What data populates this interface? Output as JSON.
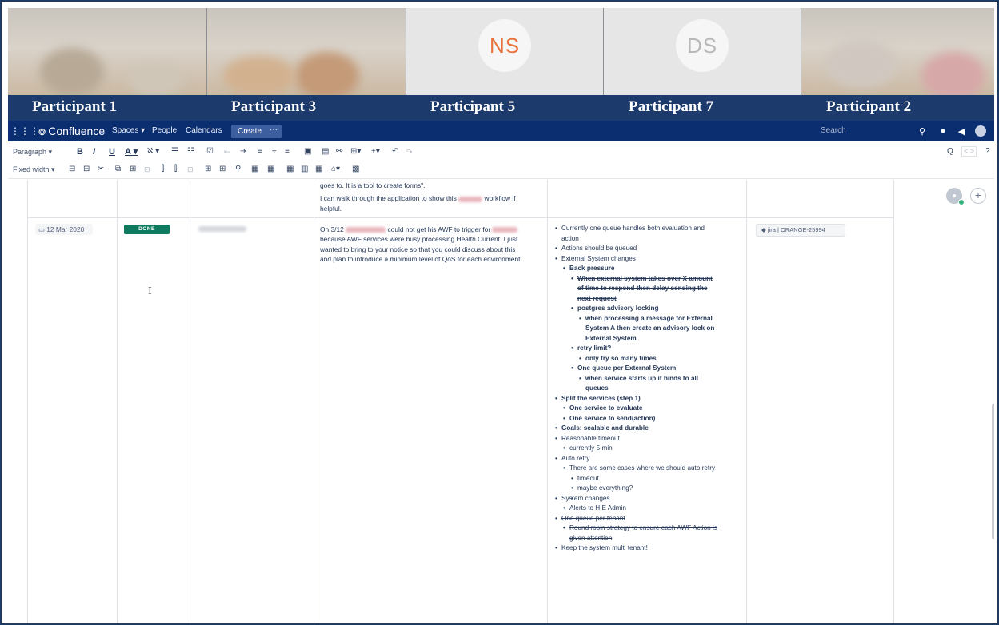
{
  "participants": {
    "tiles": [
      {
        "label": "Participant 1",
        "type": "camera"
      },
      {
        "label": "Participant 3",
        "type": "camera"
      },
      {
        "label": "Participant 5",
        "type": "avatar",
        "initials": "NS",
        "color": "#e8733c"
      },
      {
        "label": "Participant 7",
        "type": "avatar",
        "initials": "DS",
        "color": "#b8b8b8"
      },
      {
        "label": "Participant 2",
        "type": "camera"
      }
    ]
  },
  "nav": {
    "app_name": "Confluence",
    "spaces": "Spaces ▾",
    "people": "People",
    "calendars": "Calendars",
    "create": "Create",
    "more": "···",
    "search_placeholder": "Search",
    "icons": [
      "app-switcher-icon",
      "confluence-logo-icon",
      "search-icon",
      "help-icon",
      "notifications-icon",
      "user-avatar-icon"
    ]
  },
  "toolbar": {
    "paragraph": "Paragraph ▾",
    "fixed_width": "Fixed width ▾",
    "bold": "B",
    "italic": "I",
    "underline": "U",
    "text_color": "A ▾",
    "more_formatting": "ℵ ▾",
    "find": "Q",
    "find_toggle": "< >",
    "help": "?"
  },
  "table": {
    "prev_row": {
      "text_line1": "goes to.  It is a tool to create forms\".",
      "text_line2": "I can walk through the application to show this workflow if",
      "text_line3": "helpful."
    },
    "row": {
      "date": "12 Mar 2020",
      "status": "DONE",
      "description": [
        "On 3/12 could not get his AWF to trigger for",
        "because AWF services were busy processing Health Current. I just",
        "wanted to bring to your notice so that you could discuss about this",
        "and plan to introduce a minimum level of QoS for each environment."
      ],
      "jira": "jira | ORANGE-25994",
      "notes": [
        {
          "text": "Currently one queue handles both evaluation and",
          "level": 0
        },
        {
          "text": "action",
          "level": 0,
          "cont": true
        },
        {
          "text": "Actions should be queued",
          "level": 0
        },
        {
          "text": "External System changes",
          "level": 0
        },
        {
          "text": "Back pressure",
          "level": 1,
          "bold": true
        },
        {
          "text": "When external system takes over X amount",
          "level": 2,
          "bold": true,
          "strike": true
        },
        {
          "text": "of time to respond then delay sending the",
          "level": 2,
          "bold": true,
          "strike": true,
          "cont": true
        },
        {
          "text": "next request",
          "level": 2,
          "bold": true,
          "strike": true,
          "cont": true
        },
        {
          "text": "postgres advisory locking",
          "level": 2,
          "bold": true
        },
        {
          "text": "when processing a message for External",
          "level": 3,
          "bold": true
        },
        {
          "text": "System A then create an advisory lock on",
          "level": 3,
          "bold": true,
          "cont": true
        },
        {
          "text": "External System",
          "level": 3,
          "bold": true,
          "cont": true
        },
        {
          "text": "retry limit?",
          "level": 2,
          "bold": true
        },
        {
          "text": "only try so many times",
          "level": 3,
          "bold": true
        },
        {
          "text": "One queue per External System",
          "level": 2,
          "bold": true
        },
        {
          "text": "when service starts up it binds to all",
          "level": 3,
          "bold": true
        },
        {
          "text": "queues",
          "level": 3,
          "bold": true,
          "cont": true
        },
        {
          "text": "Split the services (step 1)",
          "level": 0,
          "bold": true
        },
        {
          "text": "One service to evaluate",
          "level": 1,
          "bold": true
        },
        {
          "text": "One service to send(action)",
          "level": 1,
          "bold": true
        },
        {
          "text": "Goals: scalable and durable",
          "level": 0,
          "bold": true
        },
        {
          "text": "Reasonable timeout",
          "level": 0
        },
        {
          "text": "currently 5 min",
          "level": 1
        },
        {
          "text": "Auto retry",
          "level": 0
        },
        {
          "text": "There are some cases where we should auto retry",
          "level": 1
        },
        {
          "text": "timeout",
          "level": 2
        },
        {
          "text": "maybe everything?",
          "level": 2
        },
        {
          "text": "",
          "level": 2
        },
        {
          "text": "System changes",
          "level": 0
        },
        {
          "text": "Alerts to HIE Admin",
          "level": 1
        },
        {
          "text": "One queue per tenant",
          "level": 0,
          "strike": true
        },
        {
          "text": "Round robin strategy to ensure each AWF Action is",
          "level": 1,
          "strike": true
        },
        {
          "text": "given attention",
          "level": 1,
          "strike": true,
          "cont": true
        },
        {
          "text": "Keep the system multi tenant!",
          "level": 0
        }
      ]
    }
  }
}
